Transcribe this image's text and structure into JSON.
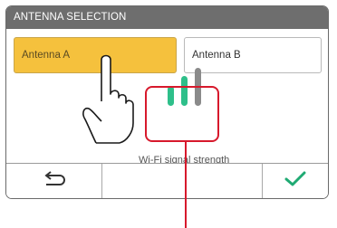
{
  "screen": {
    "title": "ANTENNA SELECTION",
    "options": [
      {
        "label": "Antenna A",
        "selected": true
      },
      {
        "label": "Antenna B",
        "selected": false
      }
    ],
    "signal_caption": "Wi-Fi signal strength",
    "signal_level": {
      "filled": 2,
      "total": 3
    }
  },
  "bottom_bar": {
    "back_icon": "return-arrow-icon",
    "confirm_icon": "checkmark-icon"
  },
  "colors": {
    "title_bar": "#6e6e6e",
    "selected_option": "#f5c13d",
    "signal_active": "#2ebf8a",
    "signal_inactive": "#8a8a8a",
    "callout": "#d7192c",
    "confirm": "#1faa73"
  }
}
